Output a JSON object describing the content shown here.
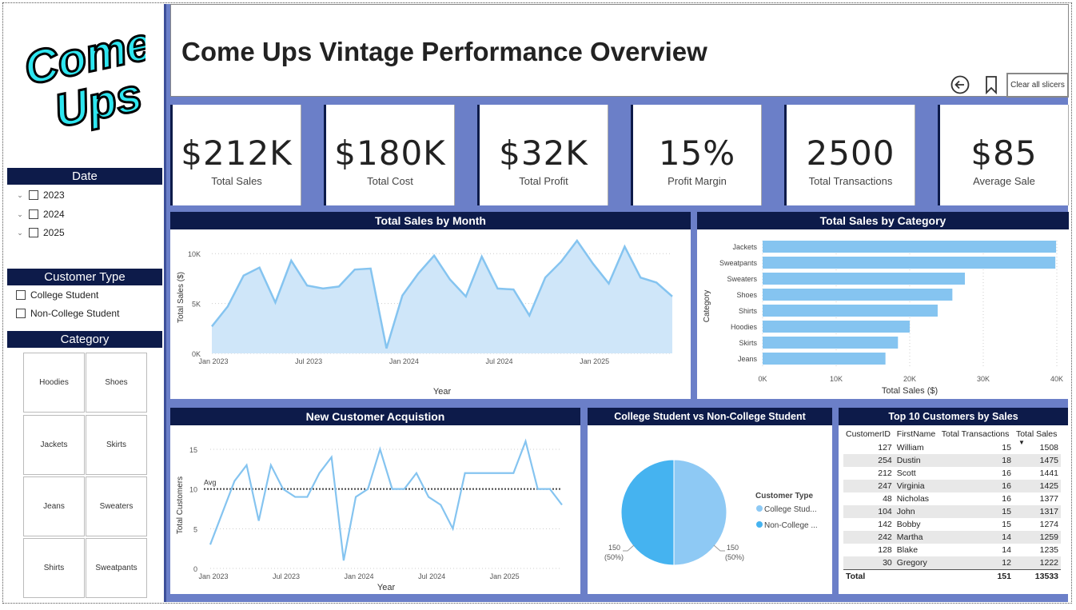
{
  "header": {
    "title": "Come Ups Vintage Performance Overview",
    "clear_slicers": "Clear all slicers",
    "logo_text": "Come Ups"
  },
  "slicers": {
    "date": {
      "title": "Date",
      "items": [
        "2023",
        "2024",
        "2025"
      ]
    },
    "customer_type": {
      "title": "Customer Type",
      "items": [
        "College Student",
        "Non-College Student"
      ]
    },
    "category": {
      "title": "Category",
      "tiles": [
        "Hoodies",
        "Shoes",
        "Jackets",
        "Skirts",
        "Jeans",
        "Sweaters",
        "Shirts",
        "Sweatpants"
      ]
    }
  },
  "kpis": [
    {
      "value": "$212K",
      "label": "Total Sales"
    },
    {
      "value": "$180K",
      "label": "Total Cost"
    },
    {
      "value": "$32K",
      "label": "Total Profit"
    },
    {
      "value": "15%",
      "label": "Profit Margin"
    },
    {
      "value": "2500",
      "label": "Total Transactions"
    },
    {
      "value": "$85",
      "label": "Average Sale"
    }
  ],
  "colors": {
    "navy": "#0d1b4a",
    "canvas": "#6b7fc8",
    "series_light": "#85c4f0",
    "area_fill": "#cfe6f9",
    "pie_dark": "#45b3f0",
    "pie_light": "#8ec9f4"
  },
  "chart_data": [
    {
      "type": "area",
      "title": "Total Sales by Month",
      "xlabel": "Year",
      "ylabel": "Total Sales ($)",
      "ylim": [
        0,
        10000
      ],
      "yticks": [
        "0K",
        "5K",
        "10K"
      ],
      "xticks": [
        "Jan 2023",
        "Jul 2023",
        "Jan 2024",
        "Jul 2024",
        "Jan 2025"
      ],
      "x": [
        "2023-01",
        "2023-02",
        "2023-03",
        "2023-04",
        "2023-05",
        "2023-06",
        "2023-07",
        "2023-08",
        "2023-09",
        "2023-10",
        "2023-11",
        "2023-12",
        "2024-01",
        "2024-02",
        "2024-03",
        "2024-04",
        "2024-05",
        "2024-06",
        "2024-07",
        "2024-08",
        "2024-09",
        "2024-10",
        "2024-11",
        "2024-12",
        "2025-01",
        "2025-02",
        "2025-03",
        "2025-04",
        "2025-05"
      ],
      "values": [
        2700,
        4700,
        7800,
        8600,
        5100,
        9300,
        6800,
        6500,
        6700,
        8400,
        8500,
        500,
        5800,
        8000,
        9800,
        7400,
        5700,
        9700,
        6500,
        6400,
        3800,
        7600,
        9200,
        11300,
        9000,
        7000,
        10700,
        7600,
        7100,
        5700
      ]
    },
    {
      "type": "bar",
      "orientation": "horizontal",
      "title": "Total Sales by Category",
      "xlabel": "Total Sales ($)",
      "ylabel": "Category",
      "xlim": [
        0,
        40000
      ],
      "xticks": [
        "0K",
        "10K",
        "20K",
        "30K",
        "40K"
      ],
      "categories": [
        "Jackets",
        "Sweatpants",
        "Sweaters",
        "Shoes",
        "Shirts",
        "Hoodies",
        "Skirts",
        "Jeans"
      ],
      "values": [
        39900,
        39800,
        27500,
        25800,
        23800,
        20000,
        18400,
        16700
      ]
    },
    {
      "type": "line",
      "title": "New Customer Acquistion",
      "xlabel": "Year",
      "ylabel": "Total Customers",
      "ylim": [
        0,
        16
      ],
      "yticks": [
        "0",
        "5",
        "10",
        "15"
      ],
      "xticks": [
        "Jan 2023",
        "Jul 2023",
        "Jan 2024",
        "Jul 2024",
        "Jan 2025"
      ],
      "avg_label": "Avg",
      "avg": 10,
      "values": [
        3,
        7,
        11,
        13,
        6,
        13,
        10,
        9,
        9,
        12,
        14,
        1,
        9,
        10,
        15,
        10,
        10,
        12,
        9,
        8,
        5,
        12,
        12,
        12,
        12,
        12,
        16,
        10,
        10,
        8
      ]
    },
    {
      "type": "pie",
      "title": "College Student vs Non-College Student",
      "legend_title": "Customer Type",
      "series": [
        {
          "name": "College Stud...",
          "value": 150,
          "label": "150",
          "pct": "(50%)"
        },
        {
          "name": "Non-College ...",
          "value": 150,
          "label": "150",
          "pct": "(50%)"
        }
      ]
    },
    {
      "type": "table",
      "title": "Top 10 Customers by Sales",
      "columns": [
        "CustomerID",
        "FirstName",
        "Total Transactions",
        "Total Sales"
      ],
      "rows": [
        [
          "127",
          "William",
          "15",
          "1508"
        ],
        [
          "254",
          "Dustin",
          "18",
          "1475"
        ],
        [
          "212",
          "Scott",
          "16",
          "1441"
        ],
        [
          "247",
          "Virginia",
          "16",
          "1425"
        ],
        [
          "48",
          "Nicholas",
          "16",
          "1377"
        ],
        [
          "104",
          "John",
          "15",
          "1317"
        ],
        [
          "142",
          "Bobby",
          "15",
          "1274"
        ],
        [
          "242",
          "Martha",
          "14",
          "1259"
        ],
        [
          "128",
          "Blake",
          "14",
          "1235"
        ],
        [
          "30",
          "Gregory",
          "12",
          "1222"
        ]
      ],
      "total": [
        "Total",
        "",
        "151",
        "13533"
      ]
    }
  ]
}
